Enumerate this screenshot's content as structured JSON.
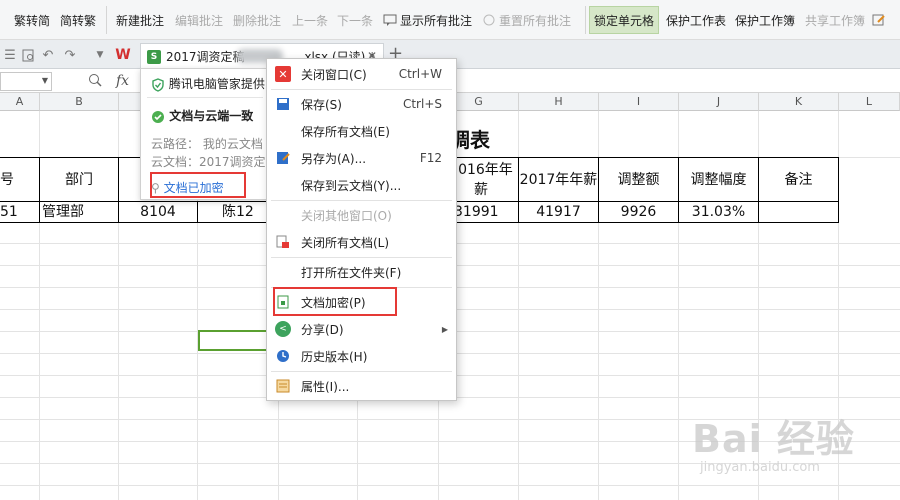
{
  "ribbon": {
    "items": [
      "繁转简",
      "简转繁",
      "新建批注",
      "编辑批注",
      "删除批注",
      "上一条",
      "下一条",
      "显示所有批注",
      "重置所有批注",
      "锁定单元格",
      "保护工作表",
      "保护工作簿",
      "共享工作簿"
    ]
  },
  "tabbar": {
    "doc_name_prefix": "2017调资定稿",
    "doc_name_suffix": ".xlsx (只读) *"
  },
  "formula": {
    "fx": "fx"
  },
  "columns": [
    "A",
    "B",
    "C",
    "D",
    "E",
    "F",
    "G",
    "H",
    "I",
    "J",
    "K",
    "L"
  ],
  "sheet": {
    "title": "调表",
    "headers": [
      "号",
      "部门",
      "",
      "",
      "2016年年薪",
      "2017年年薪",
      "调整额",
      "调整幅度",
      "备注"
    ],
    "row1": [
      "51",
      "管理部",
      "8104",
      "陈12",
      "31991",
      "41917",
      "9926",
      "31.03%",
      ""
    ]
  },
  "cloud_popup": {
    "brand": "腾讯电脑管家提供",
    "status": "文档与云端一致",
    "path": "云路径： 我的云文档",
    "doc": "云文档：2017调资定",
    "encrypted": "文档已加密"
  },
  "menu": {
    "items": [
      {
        "label": "关闭窗口(C)",
        "shortcut": "Ctrl+W"
      },
      {
        "label": "保存(S)",
        "shortcut": "Ctrl+S"
      },
      {
        "label": "保存所有文档(E)",
        "shortcut": ""
      },
      {
        "label": "另存为(A)...",
        "shortcut": "F12"
      },
      {
        "label": "保存到云文档(Y)...",
        "shortcut": ""
      },
      {
        "label": "关闭其他窗口(O)",
        "shortcut": ""
      },
      {
        "label": "关闭所有文档(L)",
        "shortcut": ""
      },
      {
        "label": "打开所在文件夹(F)",
        "shortcut": ""
      },
      {
        "label": "文档加密(P)",
        "shortcut": ""
      },
      {
        "label": "分享(D)",
        "shortcut": ""
      },
      {
        "label": "历史版本(H)",
        "shortcut": ""
      },
      {
        "label": "属性(I)...",
        "shortcut": ""
      }
    ]
  },
  "watermark": {
    "logo": "Bai 经验",
    "url": "jingyan.baidu.com"
  },
  "colors": {
    "highlight_red": "#e53935",
    "selection_green": "#5aa030",
    "excel_green": "#3c9a47"
  }
}
